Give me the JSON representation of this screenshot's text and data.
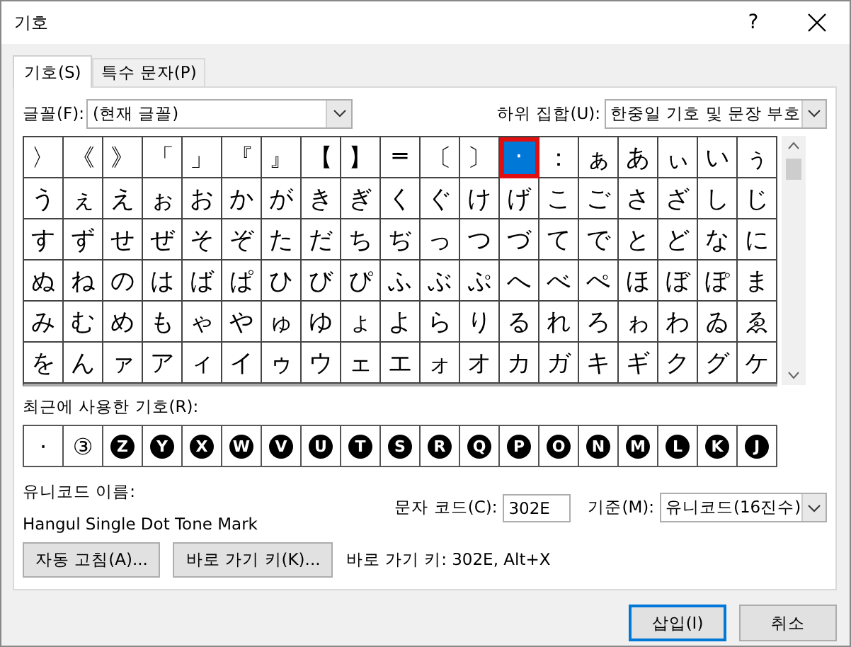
{
  "window": {
    "title": "기호",
    "help": "?"
  },
  "tabs": [
    {
      "label": "기호(S)",
      "selected": true
    },
    {
      "label": "특수 문자(P)",
      "selected": false
    }
  ],
  "font": {
    "label": "글꼴(F):",
    "value": "(현재 글꼴)"
  },
  "subset": {
    "label": "하위 집합(U):",
    "value": "한중일 기호 및 문장 부호"
  },
  "grid": [
    [
      {
        "char": "〉",
        "selected": false
      },
      {
        "char": "《",
        "selected": false
      },
      {
        "char": "》",
        "selected": false
      },
      {
        "char": "「",
        "selected": false
      },
      {
        "char": "」",
        "selected": false
      },
      {
        "char": "『",
        "selected": false
      },
      {
        "char": "』",
        "selected": false
      },
      {
        "char": "【",
        "selected": false
      },
      {
        "char": "】",
        "selected": false
      },
      {
        "char": "═",
        "selected": false
      },
      {
        "char": "〔",
        "selected": false
      },
      {
        "char": "〕",
        "selected": false
      },
      {
        "char": "·",
        "selected": true
      },
      {
        "char": "：",
        "selected": false
      },
      {
        "char": "ぁ",
        "selected": false
      },
      {
        "char": "あ",
        "selected": false
      },
      {
        "char": "ぃ",
        "selected": false
      },
      {
        "char": "い",
        "selected": false
      },
      {
        "char": "ぅ",
        "selected": false
      }
    ],
    [
      "う",
      "ぇ",
      "え",
      "ぉ",
      "お",
      "か",
      "が",
      "き",
      "ぎ",
      "く",
      "ぐ",
      "け",
      "げ",
      "こ",
      "ご",
      "さ",
      "ざ",
      "し",
      "じ"
    ],
    [
      "す",
      "ず",
      "せ",
      "ぜ",
      "そ",
      "ぞ",
      "た",
      "だ",
      "ち",
      "ぢ",
      "っ",
      "つ",
      "づ",
      "て",
      "で",
      "と",
      "ど",
      "な",
      "に"
    ],
    [
      "ぬ",
      "ね",
      "の",
      "は",
      "ば",
      "ぱ",
      "ひ",
      "び",
      "ぴ",
      "ふ",
      "ぶ",
      "ぷ",
      "へ",
      "べ",
      "ぺ",
      "ほ",
      "ぼ",
      "ぽ",
      "ま"
    ],
    [
      "み",
      "む",
      "め",
      "も",
      "ゃ",
      "や",
      "ゅ",
      "ゆ",
      "ょ",
      "よ",
      "ら",
      "り",
      "る",
      "れ",
      "ろ",
      "ゎ",
      "わ",
      "ゐ",
      "ゑ"
    ],
    [
      "を",
      "ん",
      "ァ",
      "ア",
      "ィ",
      "イ",
      "ゥ",
      "ウ",
      "ェ",
      "エ",
      "ォ",
      "オ",
      "カ",
      "ガ",
      "キ",
      "ギ",
      "ク",
      "グ",
      "ケ"
    ]
  ],
  "recent": {
    "label": "최근에 사용한 기호(R):",
    "items": [
      {
        "char": "·",
        "kind": "plain"
      },
      {
        "char": "③",
        "kind": "plain"
      },
      {
        "char": "Z",
        "kind": "negative-circled"
      },
      {
        "char": "Y",
        "kind": "negative-circled"
      },
      {
        "char": "X",
        "kind": "negative-circled"
      },
      {
        "char": "W",
        "kind": "negative-circled"
      },
      {
        "char": "V",
        "kind": "negative-circled"
      },
      {
        "char": "U",
        "kind": "negative-circled"
      },
      {
        "char": "T",
        "kind": "negative-circled"
      },
      {
        "char": "S",
        "kind": "negative-circled"
      },
      {
        "char": "R",
        "kind": "negative-circled"
      },
      {
        "char": "Q",
        "kind": "negative-circled"
      },
      {
        "char": "P",
        "kind": "negative-circled"
      },
      {
        "char": "O",
        "kind": "negative-circled"
      },
      {
        "char": "N",
        "kind": "negative-circled"
      },
      {
        "char": "M",
        "kind": "negative-circled"
      },
      {
        "char": "L",
        "kind": "negative-circled"
      },
      {
        "char": "K",
        "kind": "negative-circled"
      },
      {
        "char": "J",
        "kind": "negative-circled"
      }
    ]
  },
  "unicode_name": {
    "label": "유니코드 이름:",
    "value": "Hangul Single Dot Tone Mark"
  },
  "char_code": {
    "label": "문자 코드(C):",
    "value": "302E"
  },
  "from": {
    "label": "기준(M):",
    "value": "유니코드(16진수)"
  },
  "autocorrect_button": "자동 고침(A)...",
  "shortcut_button": "바로 가기 키(K)...",
  "shortcut_text": "바로 가기 키: 302E, Alt+X",
  "buttons": [
    {
      "label": "삽입(I)",
      "default": true
    },
    {
      "label": "취소",
      "default": false
    }
  ]
}
